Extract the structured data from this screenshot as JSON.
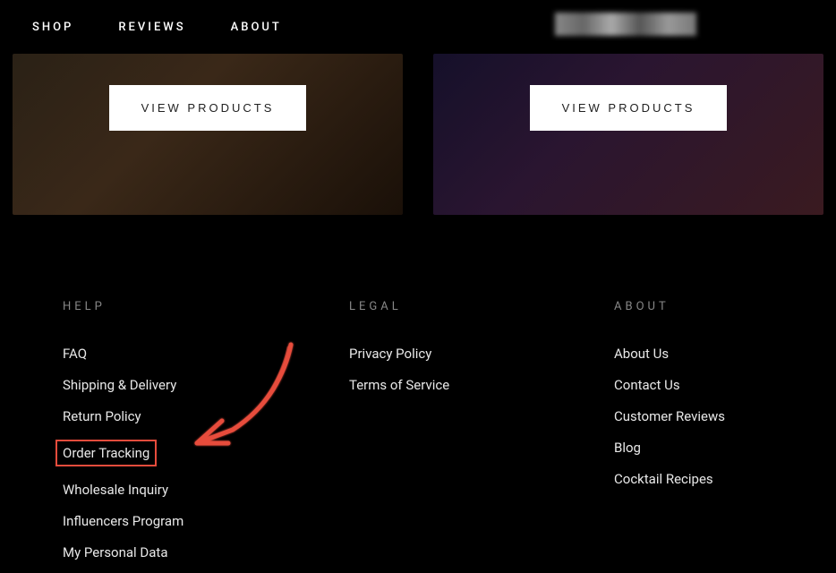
{
  "nav": {
    "shop": "SHOP",
    "reviews": "REVIEWS",
    "about": "ABOUT"
  },
  "cards": {
    "left": {
      "btn": "VIEW PRODUCTS"
    },
    "right": {
      "btn": "VIEW PRODUCTS"
    }
  },
  "footer": {
    "help": {
      "heading": "HELP",
      "links": {
        "faq": "FAQ",
        "shipping": "Shipping & Delivery",
        "return": "Return Policy",
        "tracking": "Order Tracking",
        "wholesale": "Wholesale Inquiry",
        "influencers": "Influencers Program",
        "personal_data": "My Personal Data"
      }
    },
    "legal": {
      "heading": "LEGAL",
      "links": {
        "privacy": "Privacy Policy",
        "terms": "Terms of Service"
      }
    },
    "about": {
      "heading": "ABOUT",
      "links": {
        "about_us": "About Us",
        "contact": "Contact Us",
        "reviews": "Customer Reviews",
        "blog": "Blog",
        "recipes": "Cocktail Recipes"
      }
    }
  },
  "annotation": {
    "color": "#e74c3c"
  }
}
